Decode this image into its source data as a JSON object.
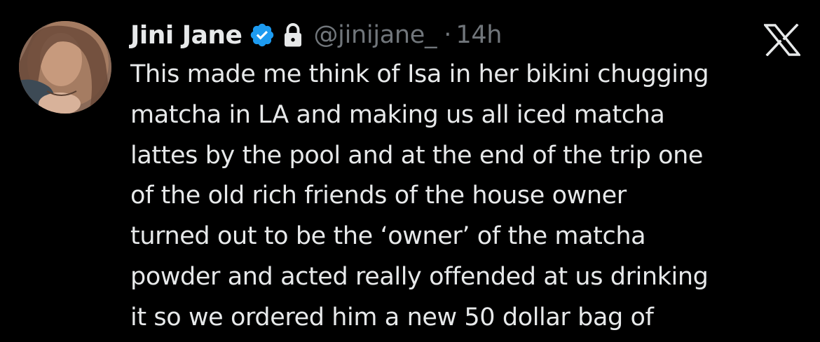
{
  "tweet": {
    "author_name": "Jini Jane",
    "handle": "@jinijane_",
    "separator": "·",
    "time": "14h",
    "verified_color": "#1d9bf0",
    "text_lines": [
      "This made me think of Isa in her bikini chugging",
      "matcha in LA and making us all iced matcha",
      "lattes by the pool and at the end of the trip one",
      "of the old rich friends of the house owner",
      "turned out to be the ‘owner’ of the matcha",
      "powder and acted really offended at us drinking",
      "it so we ordered him a new 50 dollar bag of"
    ],
    "icons": {
      "verified": "verified-badge-icon",
      "protected": "lock-icon",
      "platform": "x-logo-icon"
    }
  },
  "colors": {
    "background": "#000000",
    "primary_text": "#e7e9ea",
    "secondary_text": "#71767b",
    "accent": "#1d9bf0"
  }
}
